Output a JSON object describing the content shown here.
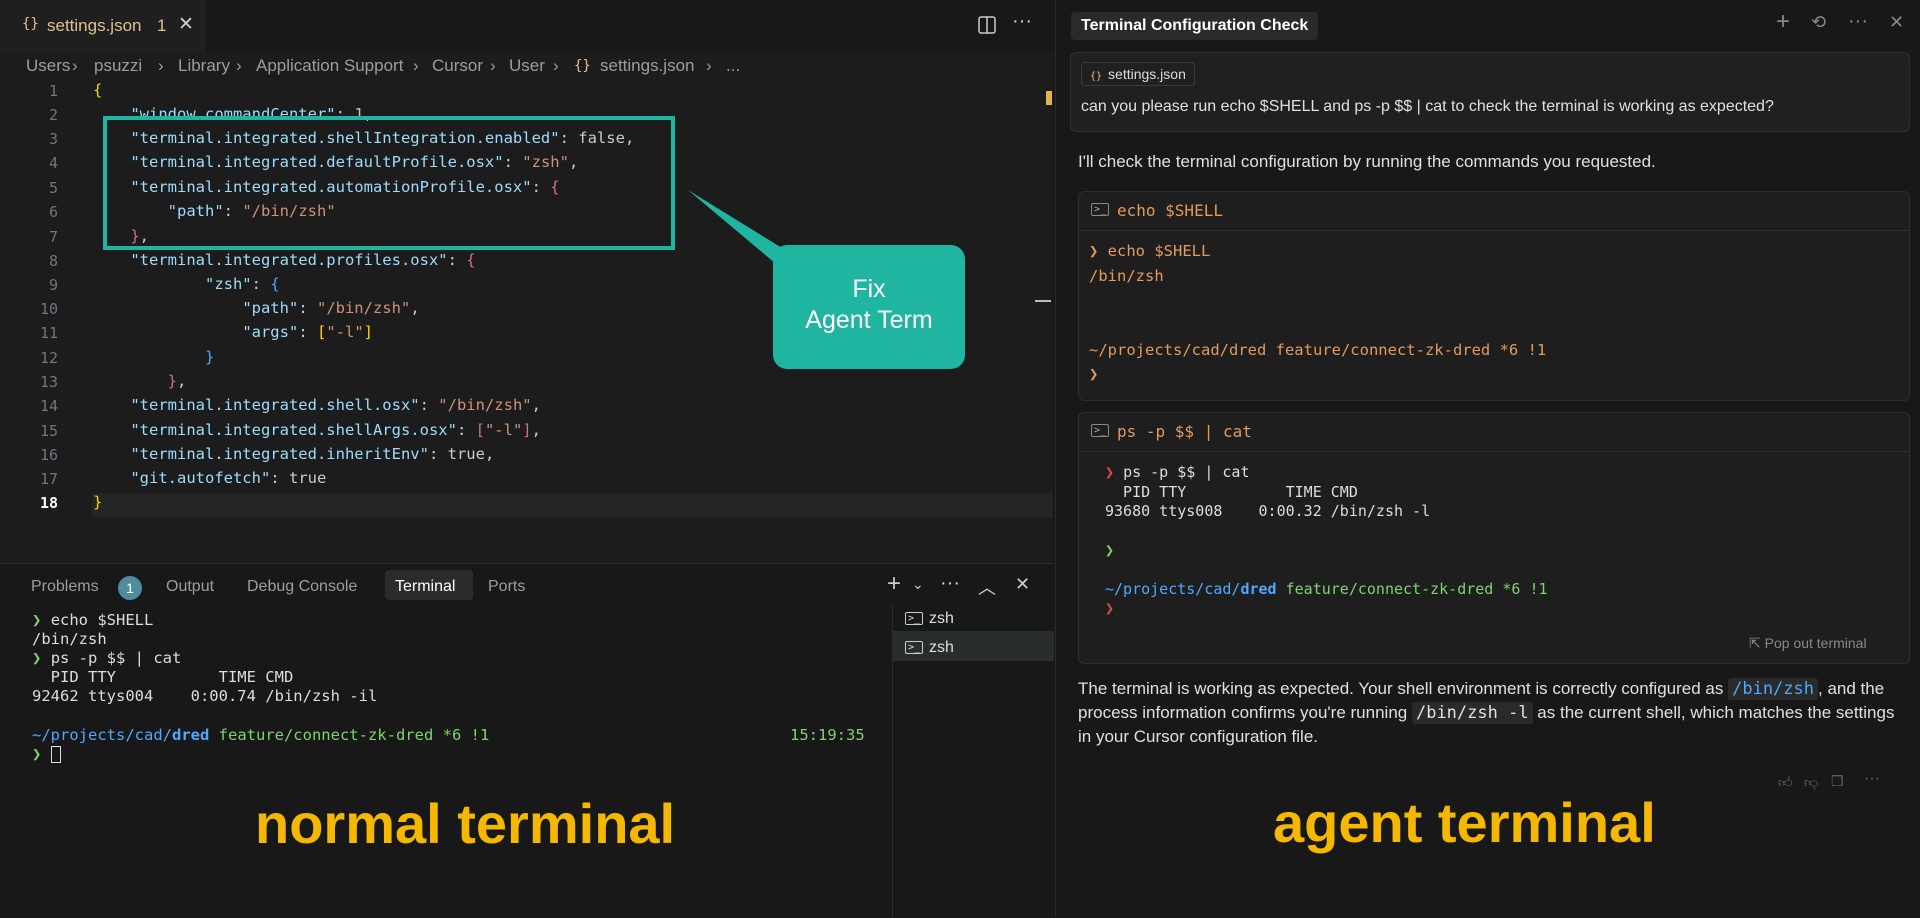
{
  "editor": {
    "tab_label": "settings.json",
    "tab_badge": "1",
    "breadcrumb": [
      "Users",
      "psuzzi",
      "Library",
      "Application Support",
      "Cursor",
      "User",
      "settings.json",
      "..."
    ],
    "line_numbers": [
      "1",
      "2",
      "3",
      "4",
      "5",
      "6",
      "7",
      "8",
      "9",
      "10",
      "11",
      "12",
      "13",
      "14",
      "15",
      "16",
      "17",
      "18"
    ],
    "code": {
      "l2_key": "\"window.commandCenter\"",
      "l2_val": "1",
      "l3_key": "\"terminal.integrated.shellIntegration.enabled\"",
      "l3_val": "false",
      "l4_key": "\"terminal.integrated.defaultProfile.osx\"",
      "l4_val": "\"zsh\"",
      "l5_key": "\"terminal.integrated.automationProfile.osx\"",
      "l6_key": "\"path\"",
      "l6_val": "\"/bin/zsh\"",
      "l8_key": "\"terminal.integrated.profiles.osx\"",
      "l9_key": "\"zsh\"",
      "l10_key": "\"path\"",
      "l10_val": "\"/bin/zsh\"",
      "l11_key": "\"args\"",
      "l11_val": "\"-l\"",
      "l14_key": "\"terminal.integrated.shell.osx\"",
      "l14_val": "\"/bin/zsh\"",
      "l15_key": "\"terminal.integrated.shellArgs.osx\"",
      "l15_val": "\"-l\"",
      "l16_key": "\"terminal.integrated.inheritEnv\"",
      "l16_val": "true",
      "l17_key": "\"git.autofetch\"",
      "l17_val": "true"
    },
    "callout": {
      "line1": "Fix",
      "line2": "Agent Term"
    }
  },
  "panel": {
    "tabs": [
      "Problems",
      "Output",
      "Debug Console",
      "Terminal",
      "Ports"
    ],
    "problems_count": "1",
    "terminal_lines": [
      "echo $SHELL",
      "/bin/zsh",
      "ps -p $$ | cat",
      "  PID TTY           TIME CMD",
      "92462 ttys004    0:00.74 /bin/zsh -il"
    ],
    "prompt_path": "~/projects/cad/",
    "prompt_dir": "dred",
    "prompt_branch": "feature/connect-zk-dred *6 !1",
    "time": "15:19:35",
    "terminal_list": [
      "zsh",
      "zsh"
    ]
  },
  "chat": {
    "title": "Terminal Configuration Check",
    "context_file": "settings.json",
    "user_message": "can you please run echo $SHELL and ps -p $$ | cat to check the terminal is working as expected?",
    "intro": "I'll check the terminal configuration by running the commands you requested.",
    "cmd1": {
      "header": "echo $SHELL",
      "lines": [
        "echo $SHELL",
        "/bin/zsh"
      ],
      "prompt": "~/projects/cad/dred feature/connect-zk-dred *6 !1"
    },
    "cmd2": {
      "header": "ps -p $$ | cat",
      "lines": [
        "ps -p $$ | cat",
        "  PID TTY           TIME CMD",
        "93680 ttys008    0:00.32 /bin/zsh -l"
      ],
      "prompt_path": "~/projects/cad/",
      "prompt_dir": "dred",
      "prompt_branch": "feature/connect-zk-dred *6 !1",
      "popout": "Pop out terminal"
    },
    "summary_a": "The terminal is working as expected. Your shell environment is correctly configured as",
    "summary_code1": "/bin/zsh",
    "summary_b": ", and the process information confirms you're running",
    "summary_code2": "/bin/zsh -l",
    "summary_c": "as the current shell, which matches the settings in your Cursor configuration file."
  },
  "labels": {
    "left": "normal terminal",
    "right": "agent terminal"
  },
  "colors": {
    "highlight_box": "#1fb5a0",
    "label": "#f5b800"
  }
}
